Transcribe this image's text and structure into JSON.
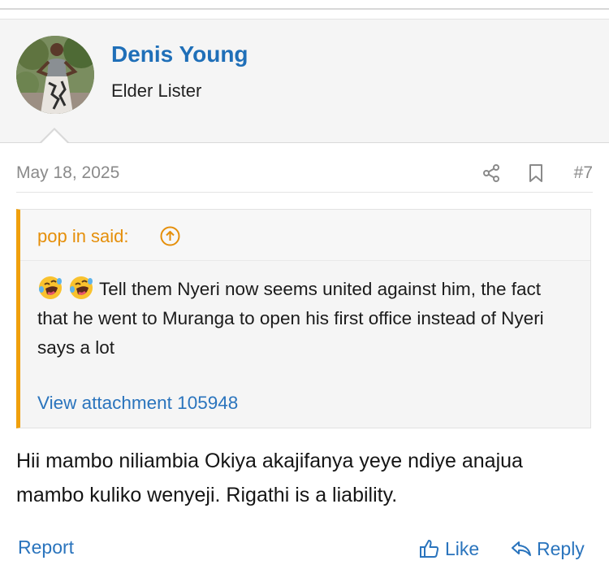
{
  "user": {
    "name": "Denis Young",
    "title": "Elder Lister"
  },
  "post": {
    "date": "May 18, 2025",
    "number": "#7",
    "body": "Hii mambo niliambia Okiya akajifanya yeye ndiye anajua mambo kuliko wenyeji. Rigathi is a liability."
  },
  "quote": {
    "author": "pop in said:",
    "text": "Tell them Nyeri now seems united against him, the fact that he went to Muranga to open his first office instead of Nyeri says a lot",
    "emojis": [
      "rolling-on-floor-laughing",
      "rolling-on-floor-laughing"
    ],
    "attachment": "View attachment 105948"
  },
  "actions": {
    "report": "Report",
    "like": "Like",
    "reply": "Reply"
  },
  "colors": {
    "link": "#2a74bd",
    "username": "#1f6fb8",
    "quote_accent": "#f0a00c",
    "quote_author": "#e58f0a"
  },
  "icons": [
    "share-icon",
    "bookmark-icon",
    "arrow-up-circle-icon",
    "thumbs-up-icon",
    "reply-icon"
  ]
}
